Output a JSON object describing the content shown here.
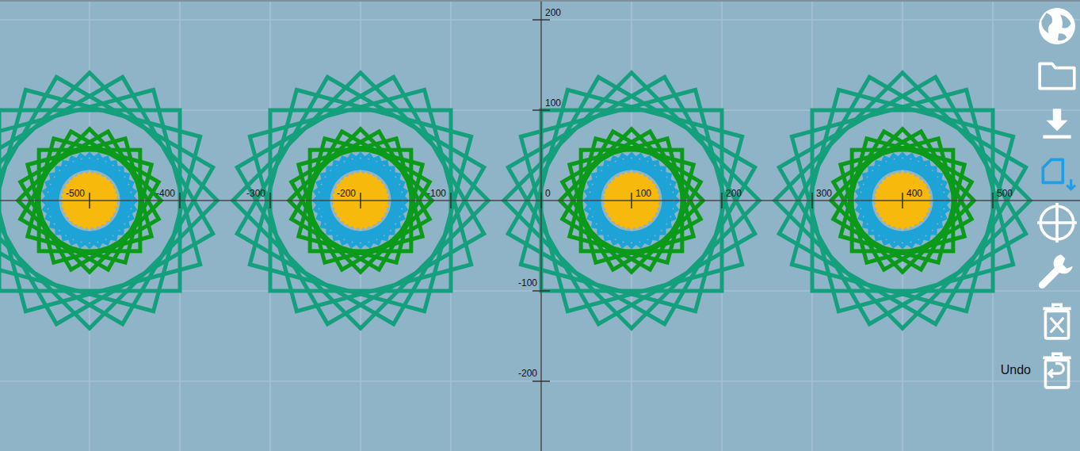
{
  "canvas": {
    "x_ticks": [
      {
        "value": -500,
        "label": "-500"
      },
      {
        "value": -400,
        "label": "-400"
      },
      {
        "value": -300,
        "label": "-300"
      },
      {
        "value": -200,
        "label": "-200"
      },
      {
        "value": -100,
        "label": "-100"
      },
      {
        "value": 0,
        "label": "0"
      },
      {
        "value": 100,
        "label": "100"
      },
      {
        "value": 200,
        "label": "200"
      },
      {
        "value": 300,
        "label": "300"
      },
      {
        "value": 400,
        "label": "400"
      },
      {
        "value": 500,
        "label": "500"
      }
    ],
    "y_ticks": [
      {
        "value": 200,
        "label": "200"
      },
      {
        "value": 100,
        "label": "100"
      },
      {
        "value": -100,
        "label": "-100"
      },
      {
        "value": -200,
        "label": "-200"
      }
    ],
    "rosettes": [
      {
        "center": [
          -500,
          0
        ]
      },
      {
        "center": [
          -200,
          0
        ]
      },
      {
        "center": [
          100,
          0
        ]
      },
      {
        "center": [
          400,
          0
        ]
      }
    ],
    "layers": [
      {
        "color": "#14a07c",
        "half_side": 100,
        "count": 6,
        "filled": false
      },
      {
        "color": "#0c9a1a",
        "half_side": 56,
        "count": 6,
        "filled": false
      },
      {
        "color": "#1ea3d6",
        "half_side": 36,
        "count": 8,
        "filled": false
      },
      {
        "color": "#f7b90c",
        "half_side": 22,
        "count": 8,
        "filled": true
      }
    ]
  },
  "tools": [
    {
      "selected": false
    },
    {
      "selected": false
    },
    {
      "selected": false
    },
    {
      "selected": true
    },
    {
      "selected": false
    },
    {
      "selected": false
    },
    {
      "selected": false
    },
    {
      "selected": false
    }
  ],
  "tooltip": {
    "text": "Undo",
    "tool_index": 7
  }
}
